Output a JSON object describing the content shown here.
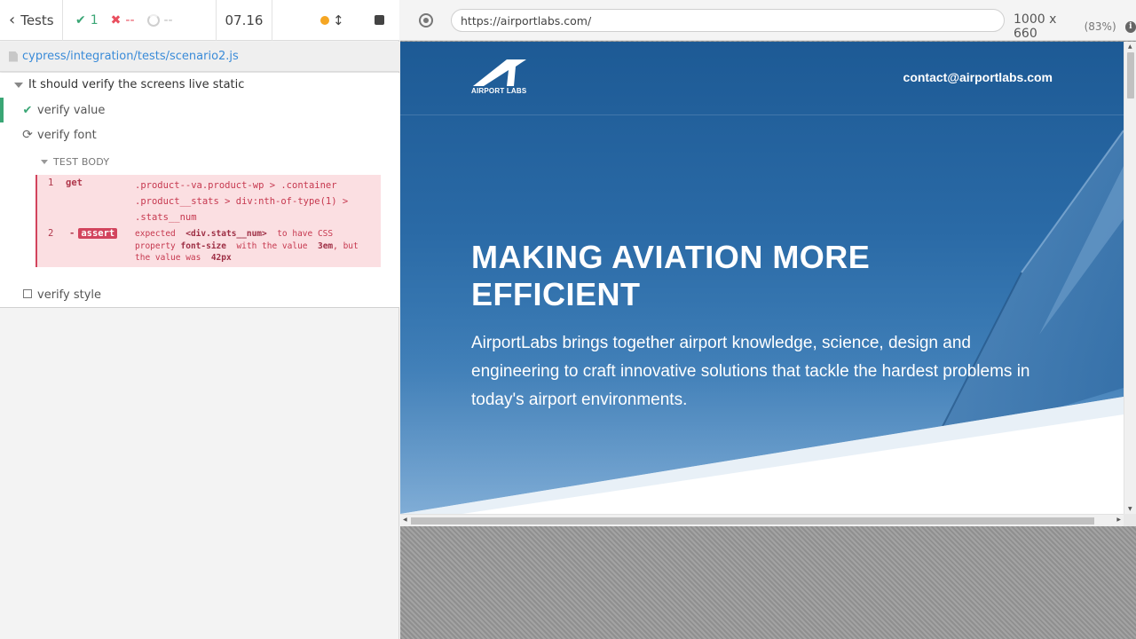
{
  "reporter": {
    "back_label": "Tests",
    "passed": "1",
    "failed": "--",
    "pending": "--",
    "duration": "07.16",
    "spec_path": "cypress/integration/tests/scenario2.js"
  },
  "suite": {
    "title": "It should verify the screens live static",
    "tests": [
      {
        "label": "verify value",
        "state": "passed"
      },
      {
        "label": "verify font",
        "state": "running"
      },
      {
        "label": "verify style",
        "state": "pending"
      }
    ],
    "body_header": "TEST BODY",
    "commands": [
      {
        "num": "1",
        "name": "get",
        "message": ".product--va.product-wp > .container .product__stats > div:nth-of-type(1) > .stats__num"
      },
      {
        "num": "2",
        "dash": "-",
        "name": "assert",
        "msg_expected": "expected",
        "msg_selector": "<div.stats__num>",
        "msg_to_have": "to have CSS property",
        "msg_property": "font-size",
        "msg_with_value": "with the value",
        "msg_expected_value": "3em",
        "msg_but": ", but the value was",
        "msg_actual_value": "42px"
      }
    ]
  },
  "browser": {
    "url": "https://airportlabs.com/",
    "viewport": "1000 x 660",
    "zoom": "(83%)",
    "info_glyph": "i"
  },
  "site": {
    "logo_text": "AIRPORT LABS",
    "contact": "contact@airportlabs.com",
    "headline": "MAKING AVIATION MORE EFFICIENT",
    "subtext": "AirportLabs brings together airport knowledge, science, design and engineering to craft innovative solutions that tackle the hardest problems in today's airport environments."
  },
  "colors": {
    "pass": "#3aa675",
    "fail": "#e94f5f",
    "link": "#3a8bd8",
    "error_bg": "#fbdfe2",
    "hero_blue": "#1d5a95"
  }
}
